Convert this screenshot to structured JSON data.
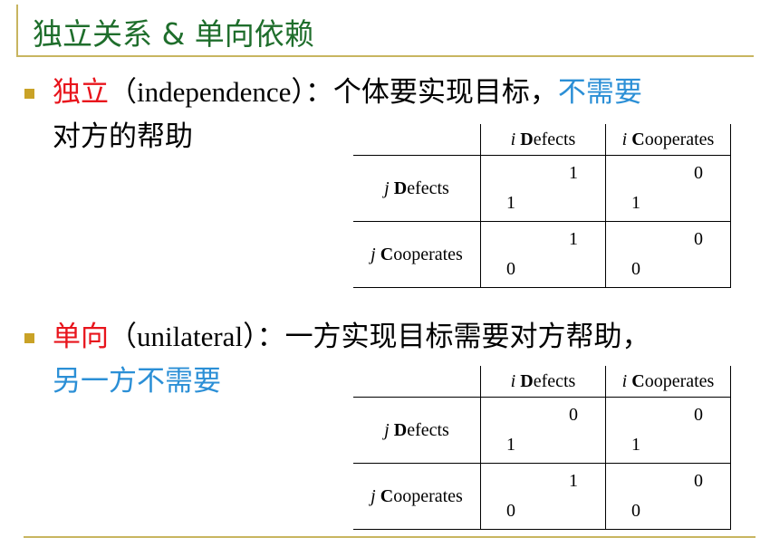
{
  "title": "独立关系 & 单向依赖",
  "section1": {
    "term": "独立",
    "paren_open": "（",
    "english": "independence",
    "paren_close": "）",
    "colon": "：",
    "desc": "个体要实现目标，",
    "highlight": "不需要",
    "line2": "对方的帮助"
  },
  "section2": {
    "term": "单向",
    "paren_open": "（",
    "english": "unilateral",
    "paren_close": "）",
    "colon": "：",
    "desc": "一方实现目标需要对方帮助，",
    "highlight_line2": "另一方不需要"
  },
  "table1": {
    "col_headers": [
      {
        "italic": "i",
        "bold_initial": "D",
        "rest": "efects"
      },
      {
        "italic": "i",
        "bold_initial": "C",
        "rest": "ooperates"
      }
    ],
    "rows": [
      {
        "label": {
          "italic": "j",
          "bold_initial": "D",
          "rest": "efects"
        },
        "cells": [
          {
            "top": "1",
            "bottom": "1"
          },
          {
            "top": "0",
            "bottom": "1"
          }
        ]
      },
      {
        "label": {
          "italic": "j",
          "bold_initial": "C",
          "rest": "ooperates"
        },
        "cells": [
          {
            "top": "1",
            "bottom": "0"
          },
          {
            "top": "0",
            "bottom": "0"
          }
        ]
      }
    ]
  },
  "table2": {
    "col_headers": [
      {
        "italic": "i",
        "bold_initial": "D",
        "rest": "efects"
      },
      {
        "italic": "i",
        "bold_initial": "C",
        "rest": "ooperates"
      }
    ],
    "rows": [
      {
        "label": {
          "italic": "j",
          "bold_initial": "D",
          "rest": "efects"
        },
        "cells": [
          {
            "top": "0",
            "bottom": "1"
          },
          {
            "top": "0",
            "bottom": "1"
          }
        ]
      },
      {
        "label": {
          "italic": "j",
          "bold_initial": "C",
          "rest": "ooperates"
        },
        "cells": [
          {
            "top": "1",
            "bottom": "0"
          },
          {
            "top": "0",
            "bottom": "0"
          }
        ]
      }
    ]
  },
  "colors": {
    "title": "#1f6e2c",
    "term": "#e8141c",
    "highlight": "#2b8fd6",
    "bullet": "#c9a227",
    "rule": "#c8b560"
  }
}
